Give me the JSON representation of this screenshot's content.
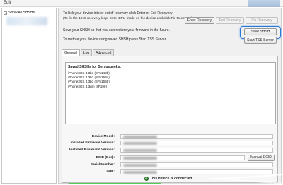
{
  "menu": {
    "edit": "Edit"
  },
  "tree": {
    "toggle": "-",
    "root": "Show All SHSHs"
  },
  "instructions": {
    "line1": "To kick your device into or out of recovery click Enter or Exit Recovery",
    "line2": "(To fix the 1015 recovery loop: Enter DFU mode on the device and click Fix Recovery)",
    "line3": "Save your SHSH so that you can restore your firmware in the future.",
    "line4": "To restore your device using saved SHSH press Start TSS Server"
  },
  "buttons": {
    "enter_recovery": "Enter Recovery",
    "exit_recovery": "Exit Recovery",
    "fix_recovery": "Fix Recovery",
    "save_shsh": "Save SHSH",
    "start_tss": "Start TSS Server",
    "manual_ecid": "Manual ECID"
  },
  "tabs": [
    {
      "label": "General",
      "active": true
    },
    {
      "label": "Log",
      "active": false
    },
    {
      "label": "Advanced",
      "active": false
    }
  ],
  "saved": {
    "title": "Saved SHSHs for Geniusgeeks:",
    "items": [
      "iPhone3GS 4.3b1 (8F5148b)",
      "iPhone3GS 4.3b2 (8F5153d)",
      "iPhone3GS 4.3b3 (8F5166b)",
      "iPhone3GS 4.3gm (8F190)"
    ]
  },
  "fields": {
    "device_model": "Device Model:",
    "firmware": "Installed Firmware Version:",
    "baseband": "Installed Baseband Version:",
    "ecid": "ECID (Dec):",
    "serial": "Serial Number:",
    "imei": "IMEI:"
  },
  "status": {
    "text": "This device is connected.",
    "progress": 0.45
  },
  "colors": {
    "highlight": "#2a78d8",
    "progress": "#2db42d"
  }
}
